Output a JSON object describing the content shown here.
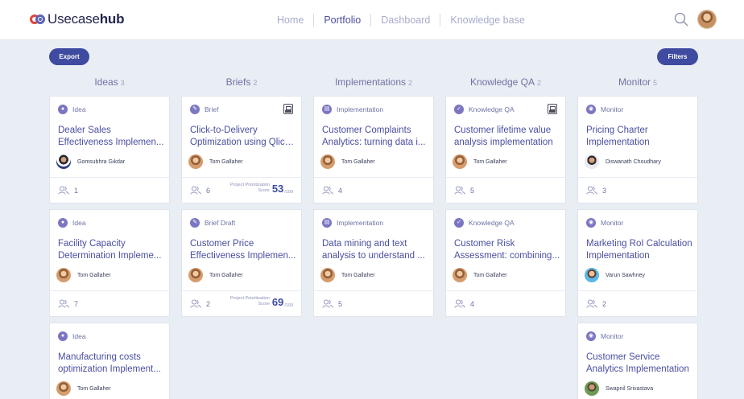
{
  "app": {
    "brand_light": "Usecase",
    "brand_bold": "hub"
  },
  "nav": [
    {
      "label": "Home",
      "active": false
    },
    {
      "label": "Portfolio",
      "active": true
    },
    {
      "label": "Dashboard",
      "active": false
    },
    {
      "label": "Knowledge base",
      "active": false
    }
  ],
  "toolbar": {
    "export_label": "Export",
    "filters_label": "Filters"
  },
  "colors": {
    "accent": "#3f4ba0",
    "type_icon": "#7b76c2",
    "link_title": "#4a4fa0",
    "brand_red": "#e2453c"
  },
  "columns": [
    {
      "title": "Ideas",
      "count": "3"
    },
    {
      "title": "Briefs",
      "count": "2"
    },
    {
      "title": "Implementations",
      "count": "2"
    },
    {
      "title": "Knowledge QA",
      "count": "2"
    },
    {
      "title": "Monitor",
      "count": "5"
    }
  ],
  "cards": {
    "c0_0": {
      "type": "Idea",
      "type_icon": "lightbulb-icon",
      "title1": "Dealer Sales",
      "title2": "Effectiveness Implemen...",
      "user": "Gomsubhra Gikdar",
      "members": "1"
    },
    "c0_1": {
      "type": "Idea",
      "type_icon": "lightbulb-icon",
      "title1": "Facility Capacity",
      "title2": "Determination Impleme...",
      "user": "Tom Gallaher",
      "members": "7"
    },
    "c0_2": {
      "type": "Idea",
      "type_icon": "lightbulb-icon",
      "title1": "Manufacturing costs",
      "title2": "optimization Implement...",
      "user": "Tom Gallaher"
    },
    "c1_0": {
      "type": "Brief",
      "type_icon": "pencil-icon",
      "title1": "Click-to-Delivery",
      "title2": "Optimization using Qlick...",
      "user": "Tom Gallaher",
      "members": "6",
      "prio_label1": "Project Prioritization",
      "prio_label2": "Score",
      "score": "53",
      "score_max": "/100"
    },
    "c1_1": {
      "type": "Brief Draft",
      "type_icon": "pencil-icon",
      "title1": "Customer Price",
      "title2": "Effectiveness Implemen...",
      "user": "Tom Gallaher",
      "members": "2",
      "prio_label1": "Project Prioritization",
      "prio_label2": "Score",
      "score": "69",
      "score_max": "/100"
    },
    "c2_0": {
      "type": "Implementation",
      "type_icon": "chart-icon",
      "title1": "Customer Complaints",
      "title2": "Analytics: turning data i...",
      "user": "Tom Gallaher",
      "members": "4"
    },
    "c2_1": {
      "type": "Implementation",
      "type_icon": "chart-icon",
      "title1": "Data mining and text",
      "title2": "analysis to understand ...",
      "user": "Tom Gallaher",
      "members": "5"
    },
    "c3_0": {
      "type": "Knowledge QA",
      "type_icon": "check-circle-icon",
      "title1": "Customer lifetime value",
      "title2": "analysis implementation",
      "user": "Tom Gallaher",
      "members": "5"
    },
    "c3_1": {
      "type": "Knowledge QA",
      "type_icon": "check-circle-icon",
      "title1": "Customer Risk",
      "title2": "Assessment: combining...",
      "user": "Tom Gallaher",
      "members": "4"
    },
    "c4_0": {
      "type": "Monitor",
      "type_icon": "eye-icon",
      "title1": "Pricing Charter",
      "title2": "Implementation",
      "user": "Diswanath Choudhary",
      "members": "3"
    },
    "c4_1": {
      "type": "Monitor",
      "type_icon": "eye-icon",
      "title1": "Marketing RoI Calculation",
      "title2": "Implementation",
      "user": "Varun Sawhney",
      "members": "2"
    },
    "c4_2": {
      "type": "Monitor",
      "type_icon": "eye-icon",
      "title1": "Customer Service",
      "title2": "Analytics Implementation",
      "user": "Swapnil Srivastava"
    }
  }
}
